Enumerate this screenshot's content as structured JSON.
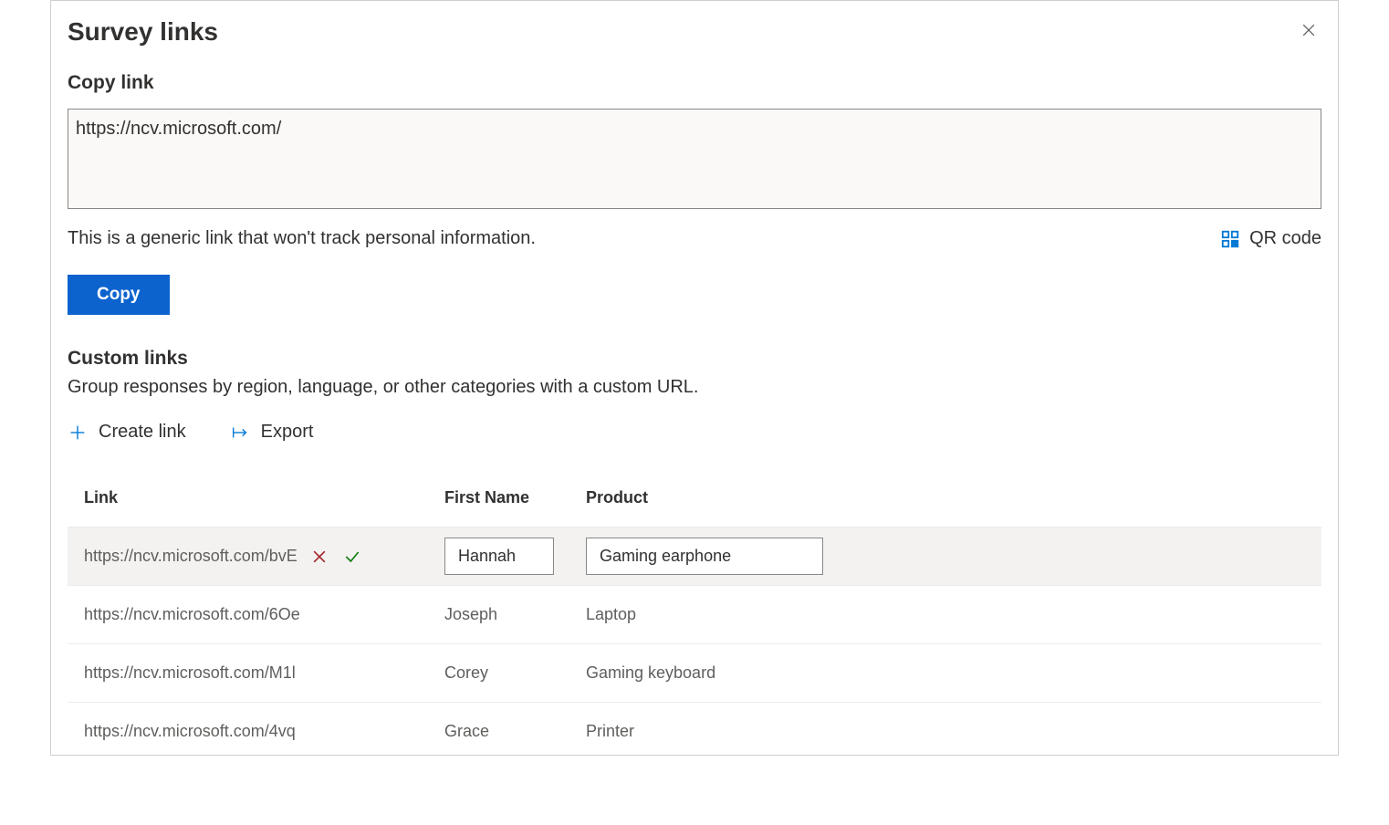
{
  "dialog": {
    "title": "Survey links"
  },
  "copyLink": {
    "heading": "Copy link",
    "value": "https://ncv.microsoft.com/",
    "infoText": "This is a generic link that won't track personal information.",
    "qrLabel": "QR code",
    "copyButton": "Copy"
  },
  "customLinks": {
    "heading": "Custom links",
    "description": "Group responses by region, language, or other categories with a custom URL.",
    "createLabel": "Create link",
    "exportLabel": "Export",
    "columns": {
      "link": "Link",
      "firstName": "First Name",
      "product": "Product"
    },
    "rows": [
      {
        "link": "https://ncv.microsoft.com/bvE",
        "firstName": "Hannah",
        "product": "Gaming earphone",
        "editing": true
      },
      {
        "link": "https://ncv.microsoft.com/6Oe",
        "firstName": "Joseph",
        "product": "Laptop",
        "editing": false
      },
      {
        "link": "https://ncv.microsoft.com/M1l",
        "firstName": "Corey",
        "product": "Gaming keyboard",
        "editing": false
      },
      {
        "link": "https://ncv.microsoft.com/4vq",
        "firstName": "Grace",
        "product": "Printer",
        "editing": false
      }
    ]
  }
}
